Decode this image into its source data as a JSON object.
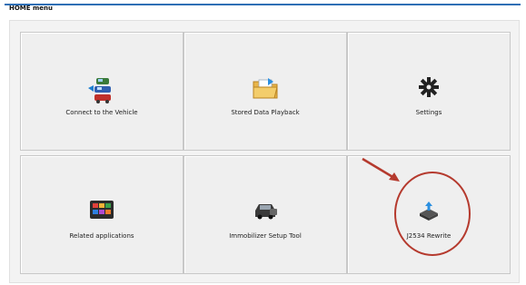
{
  "window": {
    "title": "HOME menu"
  },
  "tiles": [
    {
      "label": "Connect to the Vehicle",
      "icon": "vehicles-icon"
    },
    {
      "label": "Stored Data Playback",
      "icon": "folder-icon"
    },
    {
      "label": "Settings",
      "icon": "gear-icon"
    },
    {
      "label": "Related applications",
      "icon": "apps-grid-icon"
    },
    {
      "label": "Immobilizer Setup Tool",
      "icon": "car-key-icon"
    },
    {
      "label": "J2534 Rewrite",
      "icon": "ecu-download-icon"
    }
  ],
  "annotation": {
    "arrow_color": "#b53a2e",
    "circle_color": "#b53a2e"
  }
}
